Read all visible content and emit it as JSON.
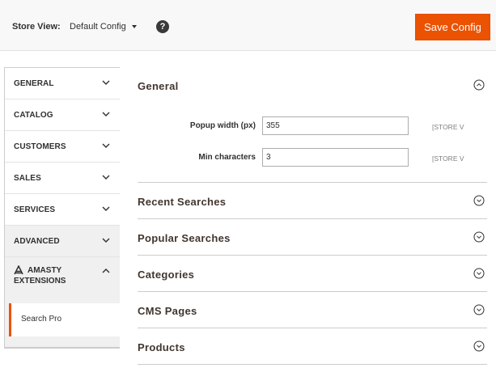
{
  "header": {
    "store_view_label": "Store View:",
    "store_view_value": "Default Config",
    "help_symbol": "?",
    "save_label": "Save Config",
    "accent_color": "#eb5202"
  },
  "sidebar": {
    "items": [
      {
        "label": "GENERAL"
      },
      {
        "label": "CATALOG"
      },
      {
        "label": "CUSTOMERS"
      },
      {
        "label": "SALES"
      },
      {
        "label": "SERVICES"
      },
      {
        "label": "ADVANCED"
      }
    ],
    "amasty": {
      "label_line1": "AMASTY",
      "label_line2": "EXTENSIONS",
      "logo": "amasty-logo-icon"
    },
    "active_sub_item": "Search Pro"
  },
  "main": {
    "sections": [
      {
        "title": "General",
        "expanded": true
      },
      {
        "title": "Recent Searches",
        "expanded": false
      },
      {
        "title": "Popular Searches",
        "expanded": false
      },
      {
        "title": "Categories",
        "expanded": false
      },
      {
        "title": "CMS Pages",
        "expanded": false
      },
      {
        "title": "Products",
        "expanded": false
      }
    ],
    "general_fields": [
      {
        "label": "Popup width (px)",
        "value": "355",
        "scope": "[STORE V"
      },
      {
        "label": "Min characters",
        "value": "3",
        "scope": "[STORE V"
      }
    ]
  }
}
